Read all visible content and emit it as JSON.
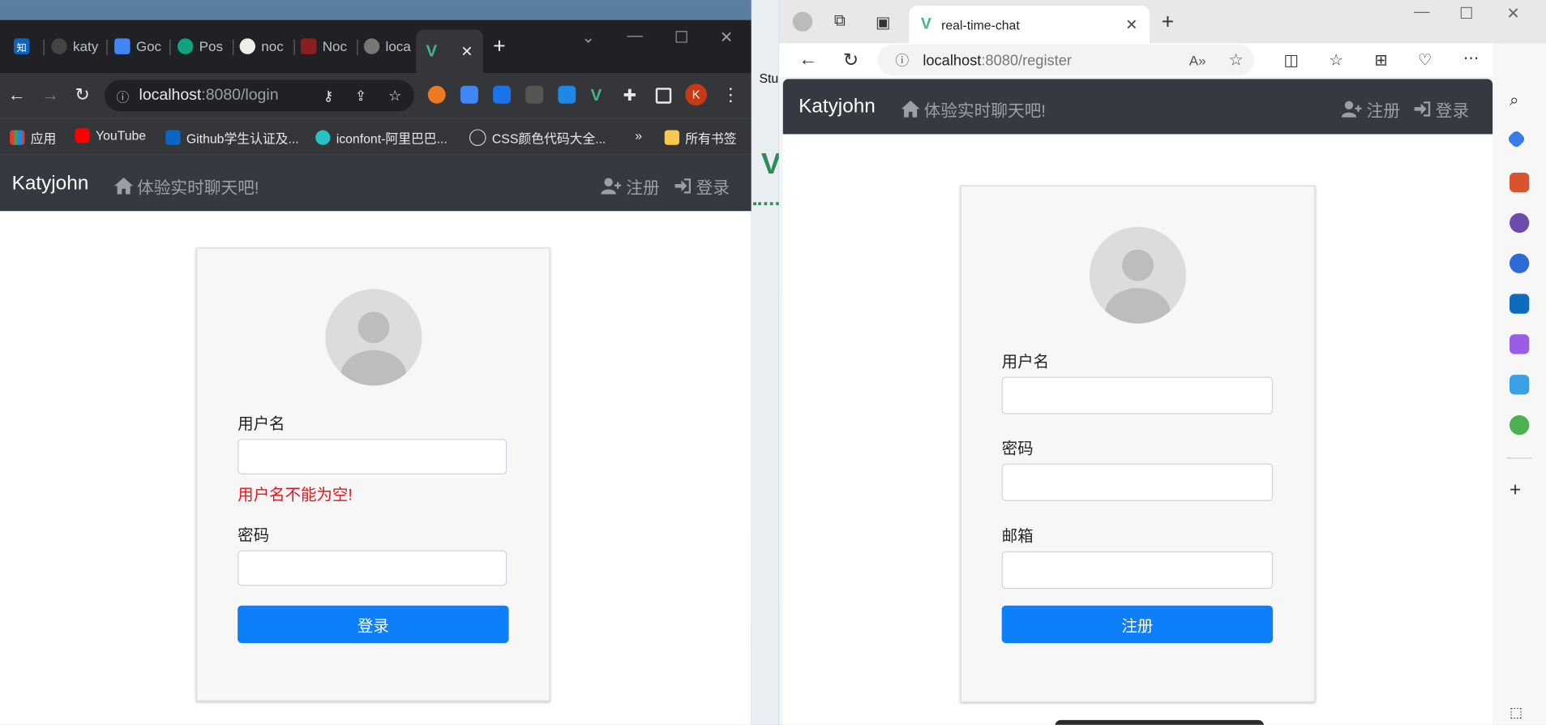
{
  "chrome": {
    "tabs": [
      "知",
      "katy",
      "Goc",
      "Pos",
      "noc",
      "Noc",
      "loca"
    ],
    "url_host": "localhost",
    "url_path": ":8080/login",
    "bookmarks": [
      "应用",
      "YouTube",
      "Github学生认证及...",
      "iconfont-阿里巴巴...",
      "CSS颜色代码大全...",
      "»",
      "所有书签"
    ],
    "profile_letter": "K"
  },
  "login_app": {
    "brand": "Katyjohn",
    "home_link": "体验实时聊天吧!",
    "register_link": "注册",
    "login_link": "登录",
    "username_label": "用户名",
    "username_error": "用户名不能为空!",
    "password_label": "密码",
    "submit_label": "登录"
  },
  "edge": {
    "tab_title": "real-time-chat",
    "url_host": "localhost",
    "url_path": ":8080/register"
  },
  "register_app": {
    "brand": "Katyjohn",
    "home_link": "体验实时聊天吧!",
    "register_link": "注册",
    "login_link": "登录",
    "username_label": "用户名",
    "password_label": "密码",
    "email_label": "邮箱",
    "submit_label": "注册"
  },
  "desktop": {
    "stu_text": "Stu"
  }
}
